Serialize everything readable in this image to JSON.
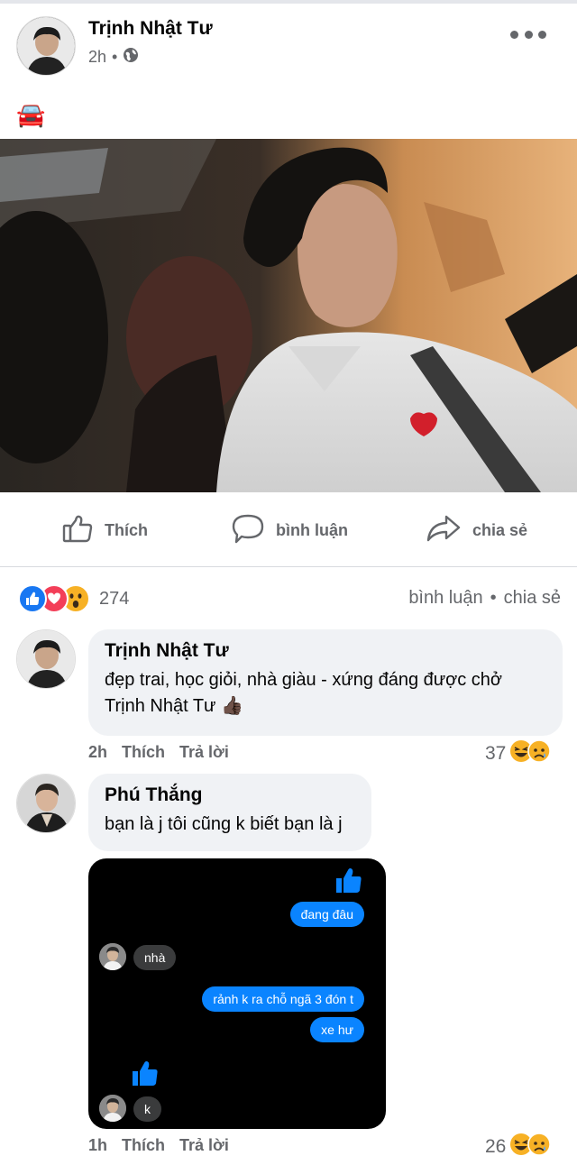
{
  "post": {
    "author": "Trịnh Nhật Tư",
    "time": "2h",
    "separator": "•",
    "text": "🚘"
  },
  "actions": {
    "like": "Thích",
    "comment": "bình luận",
    "share": "chia sẻ"
  },
  "reactions": {
    "count": "274",
    "comments_link": "bình luận",
    "separator": "•",
    "shares_link": "chia sẻ"
  },
  "comments": [
    {
      "name": "Trịnh Nhật Tư",
      "text": "đẹp trai, học giỏi, nhà giàu - xứng đáng được chở Trịnh Nhật Tư 👍🏿",
      "time": "2h",
      "like": "Thích",
      "reply": "Trả lời",
      "reaction_count": "37"
    },
    {
      "name": "Phú Thắng",
      "text": "bạn là j tôi cũng k biết bạn là j",
      "time": "1h",
      "like": "Thích",
      "reply": "Trả lời",
      "reaction_count": "26"
    }
  ],
  "chat": {
    "msg1": "đang đâu",
    "msg2": "nhà",
    "msg3": "rảnh k ra chỗ ngã 3 đón t",
    "msg4": "xe hư",
    "msg5": "k"
  },
  "colors": {
    "brand_blue": "#1877f2",
    "messenger_blue": "#0a84ff",
    "secondary_text": "#65676b",
    "bubble_bg": "#f0f2f5",
    "love_red": "#f33e58",
    "haha_yellow": "#f7b125"
  }
}
